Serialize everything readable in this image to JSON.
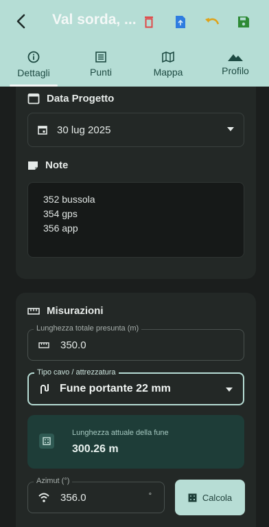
{
  "appbar": {
    "title": "Val sorda, ...",
    "actions": [
      {
        "icon": "trash-icon",
        "color": "#e04848"
      },
      {
        "icon": "export-icon",
        "color": "#2f7ce0"
      },
      {
        "icon": "undo-icon",
        "color": "#e0a218"
      },
      {
        "icon": "save-icon",
        "color": "#2e8a36"
      }
    ]
  },
  "tabs": [
    {
      "label": "Dettagli",
      "icon": "info-icon",
      "active": true
    },
    {
      "label": "Punti",
      "icon": "list-icon",
      "active": false
    },
    {
      "label": "Mappa",
      "icon": "map-icon",
      "active": false
    },
    {
      "label": "Profilo",
      "icon": "terrain-icon",
      "active": false
    }
  ],
  "project_date": {
    "title": "Data Progetto",
    "value": "30 lug 2025"
  },
  "notes": {
    "title": "Note",
    "lines": [
      "352 bussola",
      "354 gps",
      "356 app"
    ]
  },
  "measurements": {
    "title": "Misurazioni",
    "total_length": {
      "label": "Lunghezza totale presunta (m)",
      "value": "350.0"
    },
    "cable_type": {
      "label": "Tipo cavo / attrezzatura",
      "value": "Fune portante 22 mm"
    },
    "current_length": {
      "label": "Lunghezza attuale della fune",
      "value": "300.26 m"
    },
    "azimuth": {
      "label": "Azimut (°)",
      "value": "356.0",
      "unit": "°"
    },
    "calc_button": "Calcola"
  },
  "colors": {
    "appbar": "#b5ddd5",
    "background": "#1b1e1d",
    "card": "#232826",
    "accent_box": "#1e3d38"
  }
}
